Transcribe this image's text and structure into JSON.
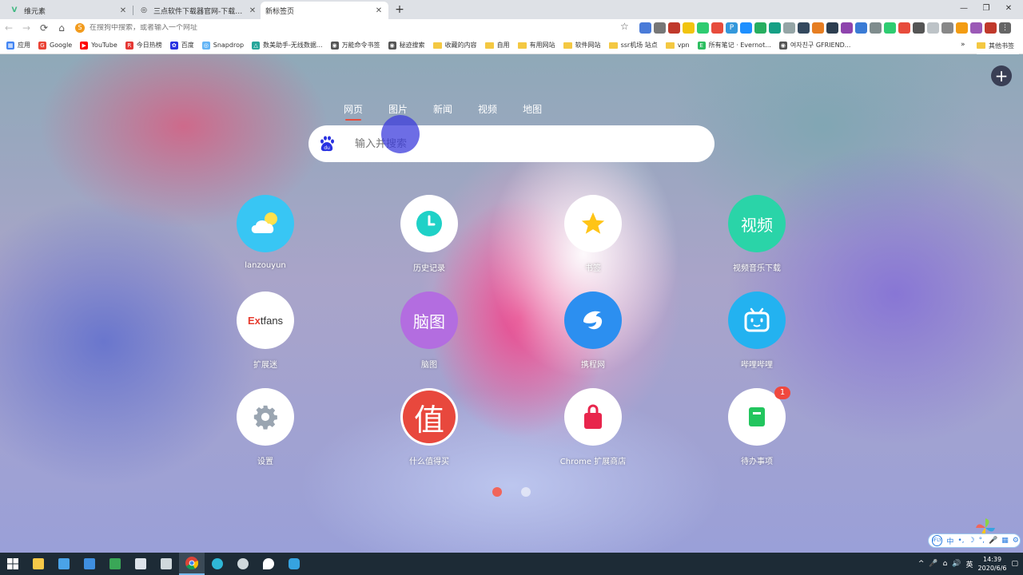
{
  "tabs": [
    {
      "title": "维元素",
      "icon": "vue-icon",
      "color": "#41b883",
      "active": false
    },
    {
      "title": "三点软件下载器官网-下载官方版",
      "icon": "globe-icon",
      "color": "#666666",
      "active": false
    },
    {
      "title": "新标签页",
      "icon": "",
      "color": "",
      "active": true
    }
  ],
  "window": {
    "new_tab": "+",
    "min": "—",
    "max": "❐",
    "close": "✕"
  },
  "toolbar": {
    "back": "←",
    "forward": "→",
    "reload": "⟳",
    "home": "⌂",
    "omnibox_placeholder": "在搜狗中搜索，或者输入一个网址",
    "star": "☆"
  },
  "bookmarks": [
    {
      "label": "应用",
      "type": "apps",
      "color": "#4285f4"
    },
    {
      "label": "Google",
      "type": "icon",
      "color": "#ea4335",
      "glyph": "G"
    },
    {
      "label": "YouTube",
      "type": "icon",
      "color": "#ff0000",
      "glyph": "▶"
    },
    {
      "label": "今日热榜",
      "type": "icon",
      "color": "#e53935",
      "glyph": "R"
    },
    {
      "label": "百度",
      "type": "icon",
      "color": "#2932e1",
      "glyph": "✿"
    },
    {
      "label": "Snapdrop",
      "type": "icon",
      "color": "#64b5f6",
      "glyph": "◎"
    },
    {
      "label": "数美助手-无线数据...",
      "type": "icon",
      "color": "#26a69a",
      "glyph": "△"
    },
    {
      "label": "万能命令书签",
      "type": "icon",
      "color": "#555555",
      "glyph": "◉"
    },
    {
      "label": "秘迹搜索",
      "type": "icon",
      "color": "#555555",
      "glyph": "◉"
    },
    {
      "label": "收藏的内容",
      "type": "folder"
    },
    {
      "label": "自用",
      "type": "folder"
    },
    {
      "label": "有用网站",
      "type": "folder"
    },
    {
      "label": "软件网站",
      "type": "folder"
    },
    {
      "label": "ssr机场 站点",
      "type": "folder"
    },
    {
      "label": "vpn",
      "type": "folder"
    },
    {
      "label": "所有笔记 · Evernot...",
      "type": "icon",
      "color": "#2dbe60",
      "glyph": "E"
    },
    {
      "label": "여자친구 GFRIEND...",
      "type": "icon",
      "color": "#555555",
      "glyph": "◉"
    }
  ],
  "bookmarks_more": "»",
  "bookmarks_other": "其他书签",
  "page": {
    "add_button": "+",
    "search_tabs": [
      {
        "label": "网页",
        "active": true
      },
      {
        "label": "图片",
        "active": false
      },
      {
        "label": "新闻",
        "active": false
      },
      {
        "label": "视频",
        "active": false
      },
      {
        "label": "地图",
        "active": false
      }
    ],
    "search_placeholder": "输入并搜索",
    "baidu_icon_text": "du",
    "shortcuts": [
      {
        "label": "lanzouyun",
        "icon": "weather-icon",
        "bg": "#38c6f4"
      },
      {
        "label": "历史记录",
        "icon": "clock-icon",
        "bg": "#ffffff"
      },
      {
        "label": "书签",
        "icon": "star-icon",
        "bg": "#ffffff"
      },
      {
        "label": "视频音乐下载",
        "icon": "video-text-icon",
        "bg": "#2ad4a8",
        "text": "视频"
      },
      {
        "label": "扩展迷",
        "icon": "extfans-logo",
        "bg": "#ffffff",
        "text_red": "Ex",
        "text_dark": "tfans"
      },
      {
        "label": "脑图",
        "icon": "mindmap-text-icon",
        "bg": "#b36de0",
        "text": "脑图"
      },
      {
        "label": "携程网",
        "icon": "dolphin-icon",
        "bg": "#2c8ff0"
      },
      {
        "label": "哔哩哔哩",
        "icon": "tv-icon",
        "bg": "#23b2f0"
      },
      {
        "label": "设置",
        "icon": "gear-icon",
        "bg": "#ffffff"
      },
      {
        "label": "什么值得买",
        "icon": "zhi-icon",
        "bg": "#ffffff",
        "text": "值"
      },
      {
        "label": "Chrome 扩展商店",
        "icon": "shopping-bag-icon",
        "bg": "#ffffff"
      },
      {
        "label": "待办事项",
        "icon": "notebook-icon",
        "bg": "#ffffff",
        "badge": "1"
      }
    ],
    "pager": {
      "pages": 2,
      "current": 1
    }
  },
  "taskbar": {
    "apps": [
      {
        "name": "file-explorer-icon",
        "color": "#f7c948",
        "active": false
      },
      {
        "name": "store-icon",
        "color": "#4aa3e8",
        "active": false
      },
      {
        "name": "mail-icon",
        "color": "#3f8fe0",
        "active": false
      },
      {
        "name": "shield-app-icon",
        "color": "#3aa757",
        "active": false
      },
      {
        "name": "monitor-icon",
        "color": "#dde3ea",
        "active": false
      },
      {
        "name": "recycle-icon",
        "color": "#cfd8dc",
        "active": false
      },
      {
        "name": "chrome-icon",
        "color": "#fbbc05",
        "active": true
      },
      {
        "name": "edge-icon",
        "color": "#2fb7d6",
        "active": false
      },
      {
        "name": "settings-app-icon",
        "color": "#cfd8dc",
        "active": false
      },
      {
        "name": "maps-icon",
        "color": "#ffffff",
        "active": false
      },
      {
        "name": "app-icon",
        "color": "#36a3e0",
        "active": false
      }
    ],
    "time": "14:39",
    "date": "2020/6/6"
  },
  "ime": {
    "lang": "中",
    "items": [
      "•,",
      "☽",
      "°,",
      "🎤",
      "▦",
      "⚙"
    ]
  }
}
